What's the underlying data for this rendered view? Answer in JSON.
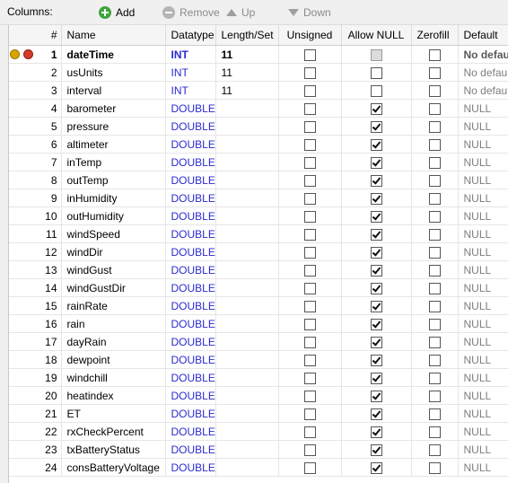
{
  "toolbar": {
    "title": "Columns:",
    "add": "Add",
    "remove": "Remove",
    "up": "Up",
    "down": "Down"
  },
  "headers": {
    "num": "#",
    "name": "Name",
    "datatype": "Datatype",
    "length": "Length/Set",
    "unsigned": "Unsigned",
    "allow_null": "Allow NULL",
    "zerofill": "Zerofill",
    "default": "Default"
  },
  "rows": [
    {
      "num": "1",
      "name": "dateTime",
      "type": "INT",
      "length": "11",
      "unsigned": false,
      "allow_null": null,
      "zerofill": false,
      "default": "No default"
    },
    {
      "num": "2",
      "name": "usUnits",
      "type": "INT",
      "length": "11",
      "unsigned": false,
      "allow_null": false,
      "zerofill": false,
      "default": "No default"
    },
    {
      "num": "3",
      "name": "interval",
      "type": "INT",
      "length": "11",
      "unsigned": false,
      "allow_null": false,
      "zerofill": false,
      "default": "No default"
    },
    {
      "num": "4",
      "name": "barometer",
      "type": "DOUBLE",
      "length": "",
      "unsigned": false,
      "allow_null": true,
      "zerofill": false,
      "default": "NULL"
    },
    {
      "num": "5",
      "name": "pressure",
      "type": "DOUBLE",
      "length": "",
      "unsigned": false,
      "allow_null": true,
      "zerofill": false,
      "default": "NULL"
    },
    {
      "num": "6",
      "name": "altimeter",
      "type": "DOUBLE",
      "length": "",
      "unsigned": false,
      "allow_null": true,
      "zerofill": false,
      "default": "NULL"
    },
    {
      "num": "7",
      "name": "inTemp",
      "type": "DOUBLE",
      "length": "",
      "unsigned": false,
      "allow_null": true,
      "zerofill": false,
      "default": "NULL"
    },
    {
      "num": "8",
      "name": "outTemp",
      "type": "DOUBLE",
      "length": "",
      "unsigned": false,
      "allow_null": true,
      "zerofill": false,
      "default": "NULL"
    },
    {
      "num": "9",
      "name": "inHumidity",
      "type": "DOUBLE",
      "length": "",
      "unsigned": false,
      "allow_null": true,
      "zerofill": false,
      "default": "NULL"
    },
    {
      "num": "10",
      "name": "outHumidity",
      "type": "DOUBLE",
      "length": "",
      "unsigned": false,
      "allow_null": true,
      "zerofill": false,
      "default": "NULL"
    },
    {
      "num": "11",
      "name": "windSpeed",
      "type": "DOUBLE",
      "length": "",
      "unsigned": false,
      "allow_null": true,
      "zerofill": false,
      "default": "NULL"
    },
    {
      "num": "12",
      "name": "windDir",
      "type": "DOUBLE",
      "length": "",
      "unsigned": false,
      "allow_null": true,
      "zerofill": false,
      "default": "NULL"
    },
    {
      "num": "13",
      "name": "windGust",
      "type": "DOUBLE",
      "length": "",
      "unsigned": false,
      "allow_null": true,
      "zerofill": false,
      "default": "NULL"
    },
    {
      "num": "14",
      "name": "windGustDir",
      "type": "DOUBLE",
      "length": "",
      "unsigned": false,
      "allow_null": true,
      "zerofill": false,
      "default": "NULL"
    },
    {
      "num": "15",
      "name": "rainRate",
      "type": "DOUBLE",
      "length": "",
      "unsigned": false,
      "allow_null": true,
      "zerofill": false,
      "default": "NULL"
    },
    {
      "num": "16",
      "name": "rain",
      "type": "DOUBLE",
      "length": "",
      "unsigned": false,
      "allow_null": true,
      "zerofill": false,
      "default": "NULL"
    },
    {
      "num": "17",
      "name": "dayRain",
      "type": "DOUBLE",
      "length": "",
      "unsigned": false,
      "allow_null": true,
      "zerofill": false,
      "default": "NULL"
    },
    {
      "num": "18",
      "name": "dewpoint",
      "type": "DOUBLE",
      "length": "",
      "unsigned": false,
      "allow_null": true,
      "zerofill": false,
      "default": "NULL"
    },
    {
      "num": "19",
      "name": "windchill",
      "type": "DOUBLE",
      "length": "",
      "unsigned": false,
      "allow_null": true,
      "zerofill": false,
      "default": "NULL"
    },
    {
      "num": "20",
      "name": "heatindex",
      "type": "DOUBLE",
      "length": "",
      "unsigned": false,
      "allow_null": true,
      "zerofill": false,
      "default": "NULL"
    },
    {
      "num": "21",
      "name": "ET",
      "type": "DOUBLE",
      "length": "",
      "unsigned": false,
      "allow_null": true,
      "zerofill": false,
      "default": "NULL"
    },
    {
      "num": "22",
      "name": "rxCheckPercent",
      "type": "DOUBLE",
      "length": "",
      "unsigned": false,
      "allow_null": true,
      "zerofill": false,
      "default": "NULL"
    },
    {
      "num": "23",
      "name": "txBatteryStatus",
      "type": "DOUBLE",
      "length": "",
      "unsigned": false,
      "allow_null": true,
      "zerofill": false,
      "default": "NULL"
    },
    {
      "num": "24",
      "name": "consBatteryVoltage",
      "type": "DOUBLE",
      "length": "",
      "unsigned": false,
      "allow_null": true,
      "zerofill": false,
      "default": "NULL"
    }
  ],
  "icons": {
    "add": "add-circle-icon",
    "remove": "remove-circle-icon",
    "up": "arrow-up-icon",
    "down": "arrow-down-icon",
    "primary_key": "key-icon",
    "foreign": "key-red-icon"
  },
  "colors": {
    "datatype_text": "#2a2ad0",
    "default_text": "#7d7d7d",
    "add_icon": "#3fa53f"
  }
}
